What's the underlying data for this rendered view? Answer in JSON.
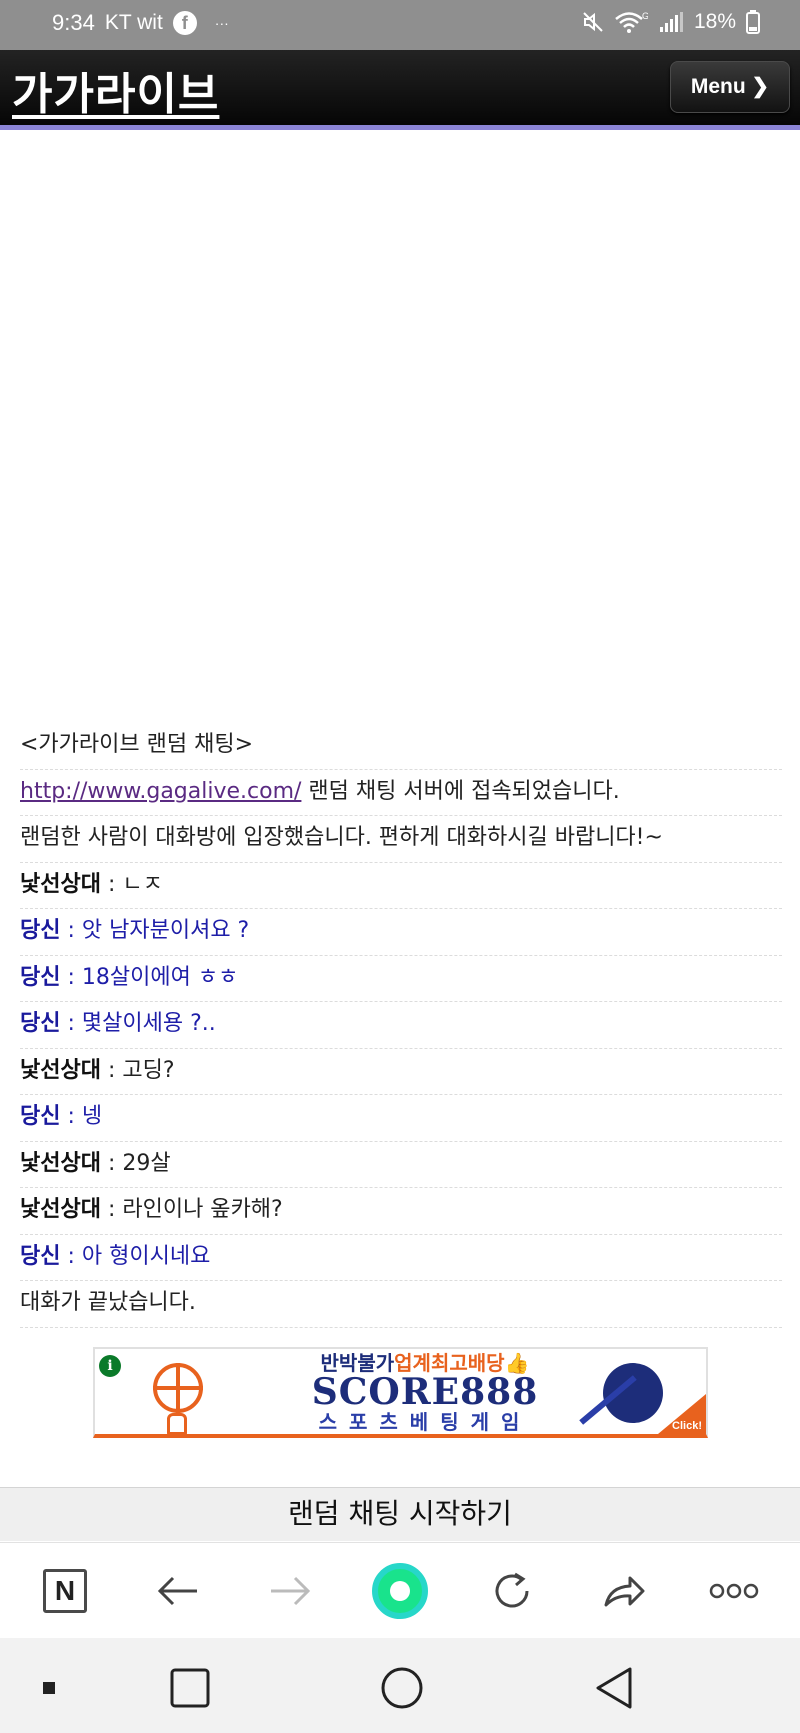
{
  "status_bar": {
    "time": "9:34",
    "carrier": "KT wit",
    "dots": "···",
    "battery": "18%"
  },
  "header": {
    "site_title": "가가라이브",
    "menu_label": "Menu ❯"
  },
  "chat": {
    "intro": "<가가라이브 랜덤 채팅>",
    "link_text": "http://www.gagalive.com/",
    "connected_text": " 랜덤 채팅 서버에 접속되었습니다.",
    "entered_text": "랜덤한 사람이 대화방에 입장했습니다. 편하게 대화하시길 바랍니다!~",
    "messages": [
      {
        "speaker": "낯선상대",
        "sep": " : ",
        "text": "ㄴㅈ"
      },
      {
        "speaker": "당신",
        "sep": " : ",
        "text": "앗 남자분이셔요 ?"
      },
      {
        "speaker": "당신",
        "sep": " : ",
        "text": "18살이에여 ㅎㅎ"
      },
      {
        "speaker": "당신",
        "sep": " : ",
        "text": "몇살이세용 ?.."
      },
      {
        "speaker": "낯선상대",
        "sep": " : ",
        "text": "고딩?"
      },
      {
        "speaker": "당신",
        "sep": " : ",
        "text": "넹"
      },
      {
        "speaker": "낯선상대",
        "sep": " : ",
        "text": "29살"
      },
      {
        "speaker": "낯선상대",
        "sep": " : ",
        "text": "라인이나 옾카해?"
      },
      {
        "speaker": "당신",
        "sep": " : ",
        "text": "아 형이시네요"
      }
    ],
    "ended_text": "대화가 끝났습니다."
  },
  "banner": {
    "info": "i",
    "line1_a": "반박불가",
    "line1_b": "업계최고배당",
    "line1_c": "👍",
    "line2": "SCORE888",
    "line3": "스포츠베팅게임",
    "click": "Click!"
  },
  "start_chat_label": "랜덤 채팅 시작하기",
  "browser": {
    "home_label": "N"
  },
  "colors": {
    "header_accent": "#8b84d6",
    "you_text": "#1e1ea8",
    "link": "#5a2a82",
    "ad_orange": "#e8621e",
    "ad_navy": "#1d2d7a",
    "green_button": "#19e38c"
  }
}
